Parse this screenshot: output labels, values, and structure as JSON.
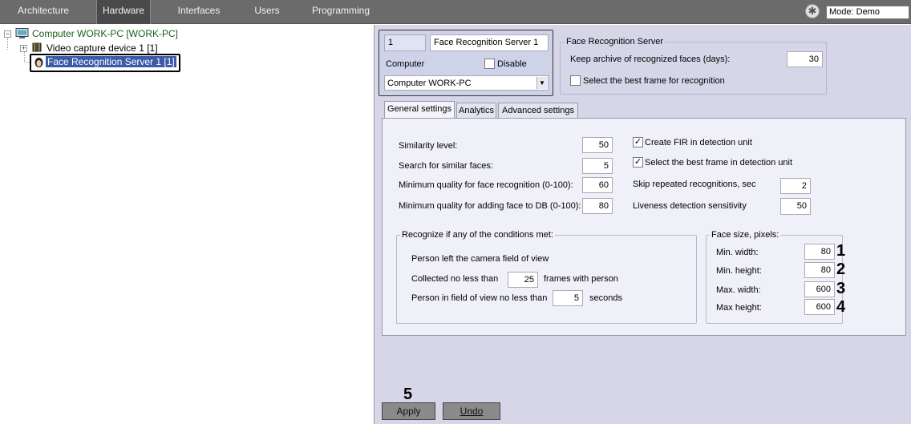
{
  "topbar": {
    "tabs": [
      "Architecture",
      "Hardware",
      "Interfaces",
      "Users",
      "Programming"
    ],
    "active_tab": "Hardware",
    "mode": "Mode: Demo"
  },
  "tree": {
    "computer": "Computer WORK-PC [WORK-PC]",
    "video": "Video capture device 1 [1]",
    "face": "Face Recognition Server 1 [1]"
  },
  "object": {
    "id": "1",
    "name": "Face Recognition Server 1",
    "computer_label": "Computer",
    "disable_label": "Disable",
    "computer_value": "Computer WORK-PC"
  },
  "frs": {
    "title": "Face Recognition Server",
    "archive_label": "Keep archive of recognized faces (days):",
    "archive_value": "30",
    "best_frame_label": "Select the best frame for recognition"
  },
  "settings_tabs": [
    "General settings",
    "Analytics",
    "Advanced settings"
  ],
  "general": {
    "similarity_label": "Similarity level:",
    "similarity_value": "50",
    "search_label": "Search for similar faces:",
    "search_value": "5",
    "minq_label": "Minimum quality for face recognition (0-100):",
    "minq_value": "60",
    "minqdb_label": "Minimum quality for adding face to DB (0-100):",
    "minqdb_value": "80",
    "fir_label": "Create FIR in detection unit",
    "bestdet_label": "Select the best frame in detection unit",
    "skip_label": "Skip repeated recognitions, sec",
    "skip_value": "2",
    "liveness_label": "Liveness detection sensitivity",
    "liveness_value": "50"
  },
  "recognize": {
    "title": "Recognize if any of the conditions met:",
    "left_label": "Person left the camera field of view",
    "collected_label": "Collected no less than",
    "collected_value": "25",
    "frames_label": "frames with person",
    "infield_label": "Person in field of view no less than",
    "infield_value": "5",
    "seconds_label": "seconds"
  },
  "face_size": {
    "title": "Face size, pixels:",
    "min_width_label": "Min. width:",
    "min_width": "80",
    "min_height_label": "Min. height:",
    "min_height": "80",
    "max_width_label": "Max. width:",
    "max_width": "600",
    "max_height_label": "Max height:",
    "max_height": "600"
  },
  "callouts": [
    "1",
    "2",
    "3",
    "4",
    "5"
  ],
  "buttons": {
    "apply": "Apply",
    "undo": "Undo"
  },
  "colors": {
    "panel": "#d6d6e8",
    "topbar": "#6b6b6b",
    "tree_text": "#1a5e1a",
    "selection": "#3b5aa8"
  }
}
